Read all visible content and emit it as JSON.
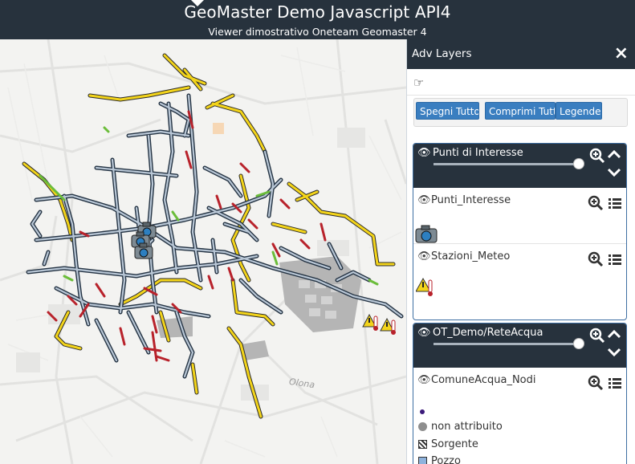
{
  "header": {
    "title": "GeoMaster Demo Javascript API4",
    "subtitle": "Viewer dimostrativo Oneteam Geomaster 4"
  },
  "map": {
    "place_label": "Olona",
    "colors": {
      "road": "#b9c7d6",
      "road_edge": "#253444",
      "main_road": "#f3d41a",
      "red_segment": "#b8222b",
      "green_segment": "#6bbd3a",
      "industrial": "#b5b5b5"
    },
    "markers": {
      "camera_icon": "camera-icon",
      "station_icon": "weather-station-icon"
    }
  },
  "panel": {
    "title": "Adv Layers",
    "close_label": "×",
    "buttons": {
      "spegni": "Spegni Tutto",
      "comprimi": "Comprimi Tutto",
      "legende": "Legende"
    },
    "groups": [
      {
        "name": "Punti di Interesse",
        "opacity": 1.0,
        "layers": [
          {
            "name": "Punti_Interesse",
            "symbol": "camera-icon"
          },
          {
            "name": "Stazioni_Meteo",
            "symbol": "weather-station-icon"
          }
        ]
      },
      {
        "name": "OT_Demo/ReteAcqua",
        "opacity": 1.0,
        "layers": [
          {
            "name": "ComuneAcqua_Nodi",
            "legend": [
              {
                "label": "",
                "symbol": "purple-dot"
              },
              {
                "label": "non attribuito",
                "symbol": "grey-circle"
              },
              {
                "label": "Sorgente",
                "symbol": "checker-square"
              },
              {
                "label": "Pozzo",
                "symbol": "blue-square"
              }
            ]
          }
        ]
      }
    ]
  }
}
